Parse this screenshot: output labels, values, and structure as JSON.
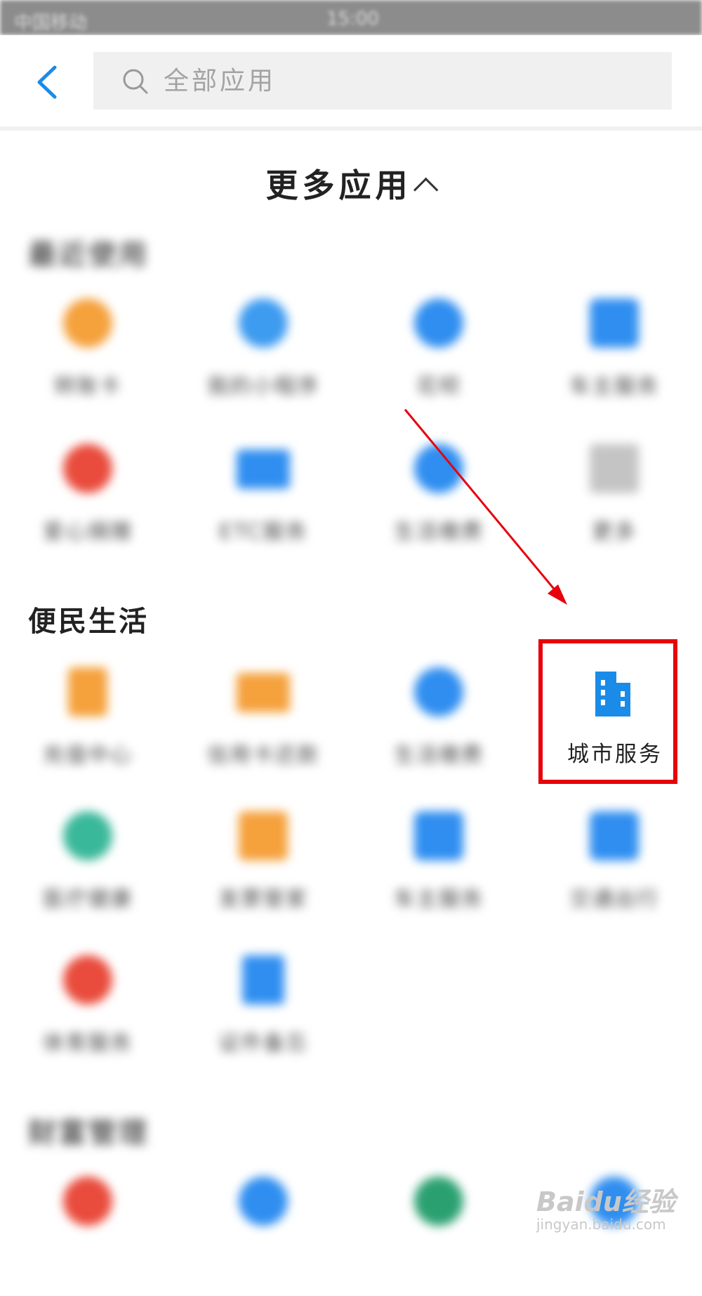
{
  "status_bar": {
    "left": "中国移动",
    "time": "15:00"
  },
  "search": {
    "placeholder": "全部应用"
  },
  "more_apps": {
    "title": "更多应用"
  },
  "sections": [
    {
      "title": "最近使用",
      "apps": [
        {
          "label": "转账卡",
          "color": "#f5a13c"
        },
        {
          "label": "我的小程序",
          "color": "#3d9bf0"
        },
        {
          "label": "花呗",
          "color": "#2f8ef0"
        },
        {
          "label": "车主服务",
          "color": "#2f8ef0"
        },
        {
          "label": "爱心捐赠",
          "color": "#e94b3c"
        },
        {
          "label": "ETC服务",
          "color": "#2f8ef0"
        },
        {
          "label": "生活缴费",
          "color": "#2f8ef0"
        },
        {
          "label": "更多",
          "color": "#b0b0b0"
        }
      ]
    },
    {
      "title": "便民生活",
      "apps": [
        {
          "label": "充值中心",
          "color": "#f5a13c"
        },
        {
          "label": "信用卡还款",
          "color": "#f5a13c"
        },
        {
          "label": "生活缴费",
          "color": "#2f8ef0"
        },
        {
          "label": "城市服务",
          "color": "#1a8be8"
        },
        {
          "label": "医疗健康",
          "color": "#3ab89a"
        },
        {
          "label": "发票管家",
          "color": "#f5a13c"
        },
        {
          "label": "车主服务",
          "color": "#2f8ef0"
        },
        {
          "label": "交通出行",
          "color": "#2f8ef0"
        },
        {
          "label": "体育服务",
          "color": "#e94b3c"
        },
        {
          "label": "证件备忘",
          "color": "#2f8ef0"
        }
      ]
    },
    {
      "title": "财富管理",
      "apps": [
        {
          "label": "",
          "color": "#e94b3c"
        },
        {
          "label": "",
          "color": "#2f8ef0"
        },
        {
          "label": "",
          "color": "#2aa070"
        },
        {
          "label": "",
          "color": "#2f8ef0"
        }
      ]
    }
  ],
  "highlighted_app": {
    "label": "城市服务",
    "color": "#1a8be8"
  },
  "watermark": {
    "line1": "Baidu经验",
    "line2": "jingyan.baidu.com"
  }
}
